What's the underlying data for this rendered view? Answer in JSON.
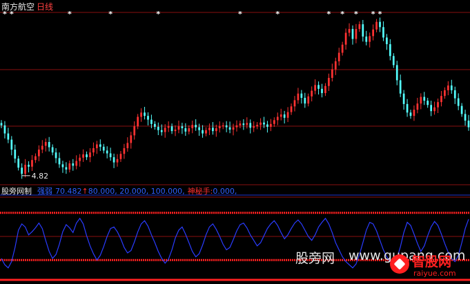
{
  "header": {
    "stock_name": "南方航空",
    "period": "日线"
  },
  "indicator_header": {
    "name": "股旁网制",
    "line_name": "强弱",
    "line_value": "70.482",
    "arrow": "↑",
    "params": "80.000, 20.000, 100.000,",
    "extra_name": "神秘手:",
    "extra_value": "0.000,"
  },
  "watermark": {
    "site_cn": "股旁网",
    "site_url": "www.gupang.com",
    "logo_text": "智股网",
    "logo_url": "raiyue.com"
  },
  "colors": {
    "background": "#000000",
    "up": "#ff3232",
    "down": "#54ffff",
    "oscillator": "#2a3cff",
    "band": "#ff2020",
    "grid": "#8a1010"
  },
  "chart_data": [
    {
      "type": "candlestick",
      "title": "南方航空 日线",
      "min_label": "4.82",
      "price_range": [
        4.6,
        8.2
      ],
      "markers": {
        "symbol": "*",
        "positions": [
          1,
          3,
          20,
          32,
          46,
          70,
          81,
          96,
          100,
          104,
          109,
          111
        ]
      },
      "x": [
        "1",
        "2",
        "3",
        "4",
        "5",
        "6",
        "7",
        "8",
        "9",
        "10",
        "11",
        "12",
        "13",
        "14",
        "15",
        "16",
        "17",
        "18",
        "19",
        "20",
        "21",
        "22",
        "23",
        "24",
        "25",
        "26",
        "27",
        "28",
        "29",
        "30",
        "31",
        "32",
        "33",
        "34",
        "35",
        "36",
        "37",
        "38",
        "39",
        "40",
        "41",
        "42",
        "43",
        "44",
        "45",
        "46",
        "47",
        "48",
        "49",
        "50",
        "51",
        "52",
        "53",
        "54",
        "55",
        "56",
        "57",
        "58",
        "59",
        "60",
        "61",
        "62",
        "63",
        "64",
        "65",
        "66",
        "67",
        "68",
        "69",
        "70",
        "71",
        "72",
        "73",
        "74",
        "75",
        "76",
        "77",
        "78",
        "79",
        "80",
        "81",
        "82",
        "83",
        "84",
        "85",
        "86",
        "87",
        "88",
        "89",
        "90",
        "91",
        "92",
        "93",
        "94",
        "95",
        "96",
        "97",
        "98",
        "99",
        "100",
        "101",
        "102",
        "103",
        "104",
        "105",
        "106",
        "107",
        "108",
        "109",
        "110",
        "111",
        "112",
        "113",
        "114",
        "115",
        "116",
        "117",
        "118",
        "119",
        "120",
        "121",
        "122",
        "123",
        "124",
        "125",
        "126",
        "127",
        "128",
        "129",
        "130",
        "131",
        "132",
        "133",
        "134",
        "135",
        "136",
        "137",
        "138"
      ],
      "close": [
        5.85,
        5.68,
        5.55,
        5.34,
        5.15,
        4.96,
        4.83,
        5.02,
        4.98,
        5.12,
        5.2,
        5.34,
        5.42,
        5.5,
        5.39,
        5.28,
        5.16,
        5.03,
        4.97,
        4.92,
        5.05,
        5.0,
        5.1,
        5.17,
        5.24,
        5.18,
        5.28,
        5.37,
        5.45,
        5.4,
        5.32,
        5.26,
        5.18,
        5.07,
        5.14,
        5.25,
        5.37,
        5.48,
        5.64,
        5.83,
        6.03,
        6.12,
        6.05,
        5.97,
        5.88,
        5.82,
        5.75,
        5.71,
        5.8,
        5.83,
        5.73,
        5.76,
        5.83,
        5.79,
        5.72,
        5.79,
        5.86,
        5.81,
        5.75,
        5.68,
        5.75,
        5.8,
        5.73,
        5.79,
        5.83,
        5.85,
        5.81,
        5.76,
        5.81,
        5.85,
        5.89,
        5.86,
        5.9,
        5.8,
        5.83,
        5.86,
        5.91,
        5.87,
        5.82,
        5.88,
        5.96,
        6.03,
        6.08,
        6.01,
        6.13,
        6.25,
        6.38,
        6.52,
        6.43,
        6.31,
        6.46,
        6.58,
        6.7,
        6.62,
        6.53,
        6.68,
        6.85,
        7.03,
        7.2,
        7.38,
        7.55,
        7.8,
        7.88,
        7.67,
        7.88,
        7.98,
        7.72,
        7.61,
        7.73,
        7.87,
        8.03,
        7.92,
        7.7,
        7.56,
        7.31,
        7.12,
        6.8,
        6.52,
        6.3,
        6.12,
        6.05,
        6.18,
        6.31,
        6.45,
        6.37,
        6.28,
        6.15,
        6.23,
        6.34,
        6.47,
        6.59,
        6.69,
        6.59,
        6.42,
        6.26,
        6.09,
        5.95,
        5.81
      ],
      "high_label": null
    },
    {
      "type": "line",
      "name": "强弱",
      "last_value": 70.482,
      "bands": [
        80,
        20
      ],
      "ylim": [
        0,
        100
      ],
      "values": [
        22,
        14,
        10,
        18,
        36,
        58,
        66,
        62,
        52,
        56,
        61,
        67,
        60,
        45,
        31,
        22,
        27,
        40,
        56,
        65,
        61,
        55,
        67,
        73,
        66,
        51,
        38,
        28,
        20,
        26,
        37,
        50,
        60,
        62,
        56,
        47,
        36,
        29,
        32,
        43,
        56,
        66,
        70,
        63,
        52,
        42,
        31,
        22,
        16,
        21,
        33,
        48,
        58,
        62,
        53,
        42,
        31,
        24,
        28,
        39,
        52,
        62,
        66,
        59,
        50,
        40,
        33,
        36,
        46,
        57,
        65,
        67,
        61,
        52,
        45,
        38,
        42,
        51,
        60,
        66,
        70,
        64,
        55,
        47,
        52,
        60,
        67,
        71,
        66,
        58,
        50,
        45,
        52,
        62,
        68,
        73,
        66,
        55,
        42,
        33,
        24,
        18,
        14,
        10,
        15,
        27,
        42,
        58,
        68,
        66,
        57,
        45,
        33,
        24,
        18,
        15,
        22,
        37,
        55,
        68,
        64,
        53,
        41,
        31,
        38,
        51,
        62,
        69,
        64,
        53,
        41,
        30,
        22,
        18,
        26,
        42,
        60,
        72
      ]
    }
  ]
}
